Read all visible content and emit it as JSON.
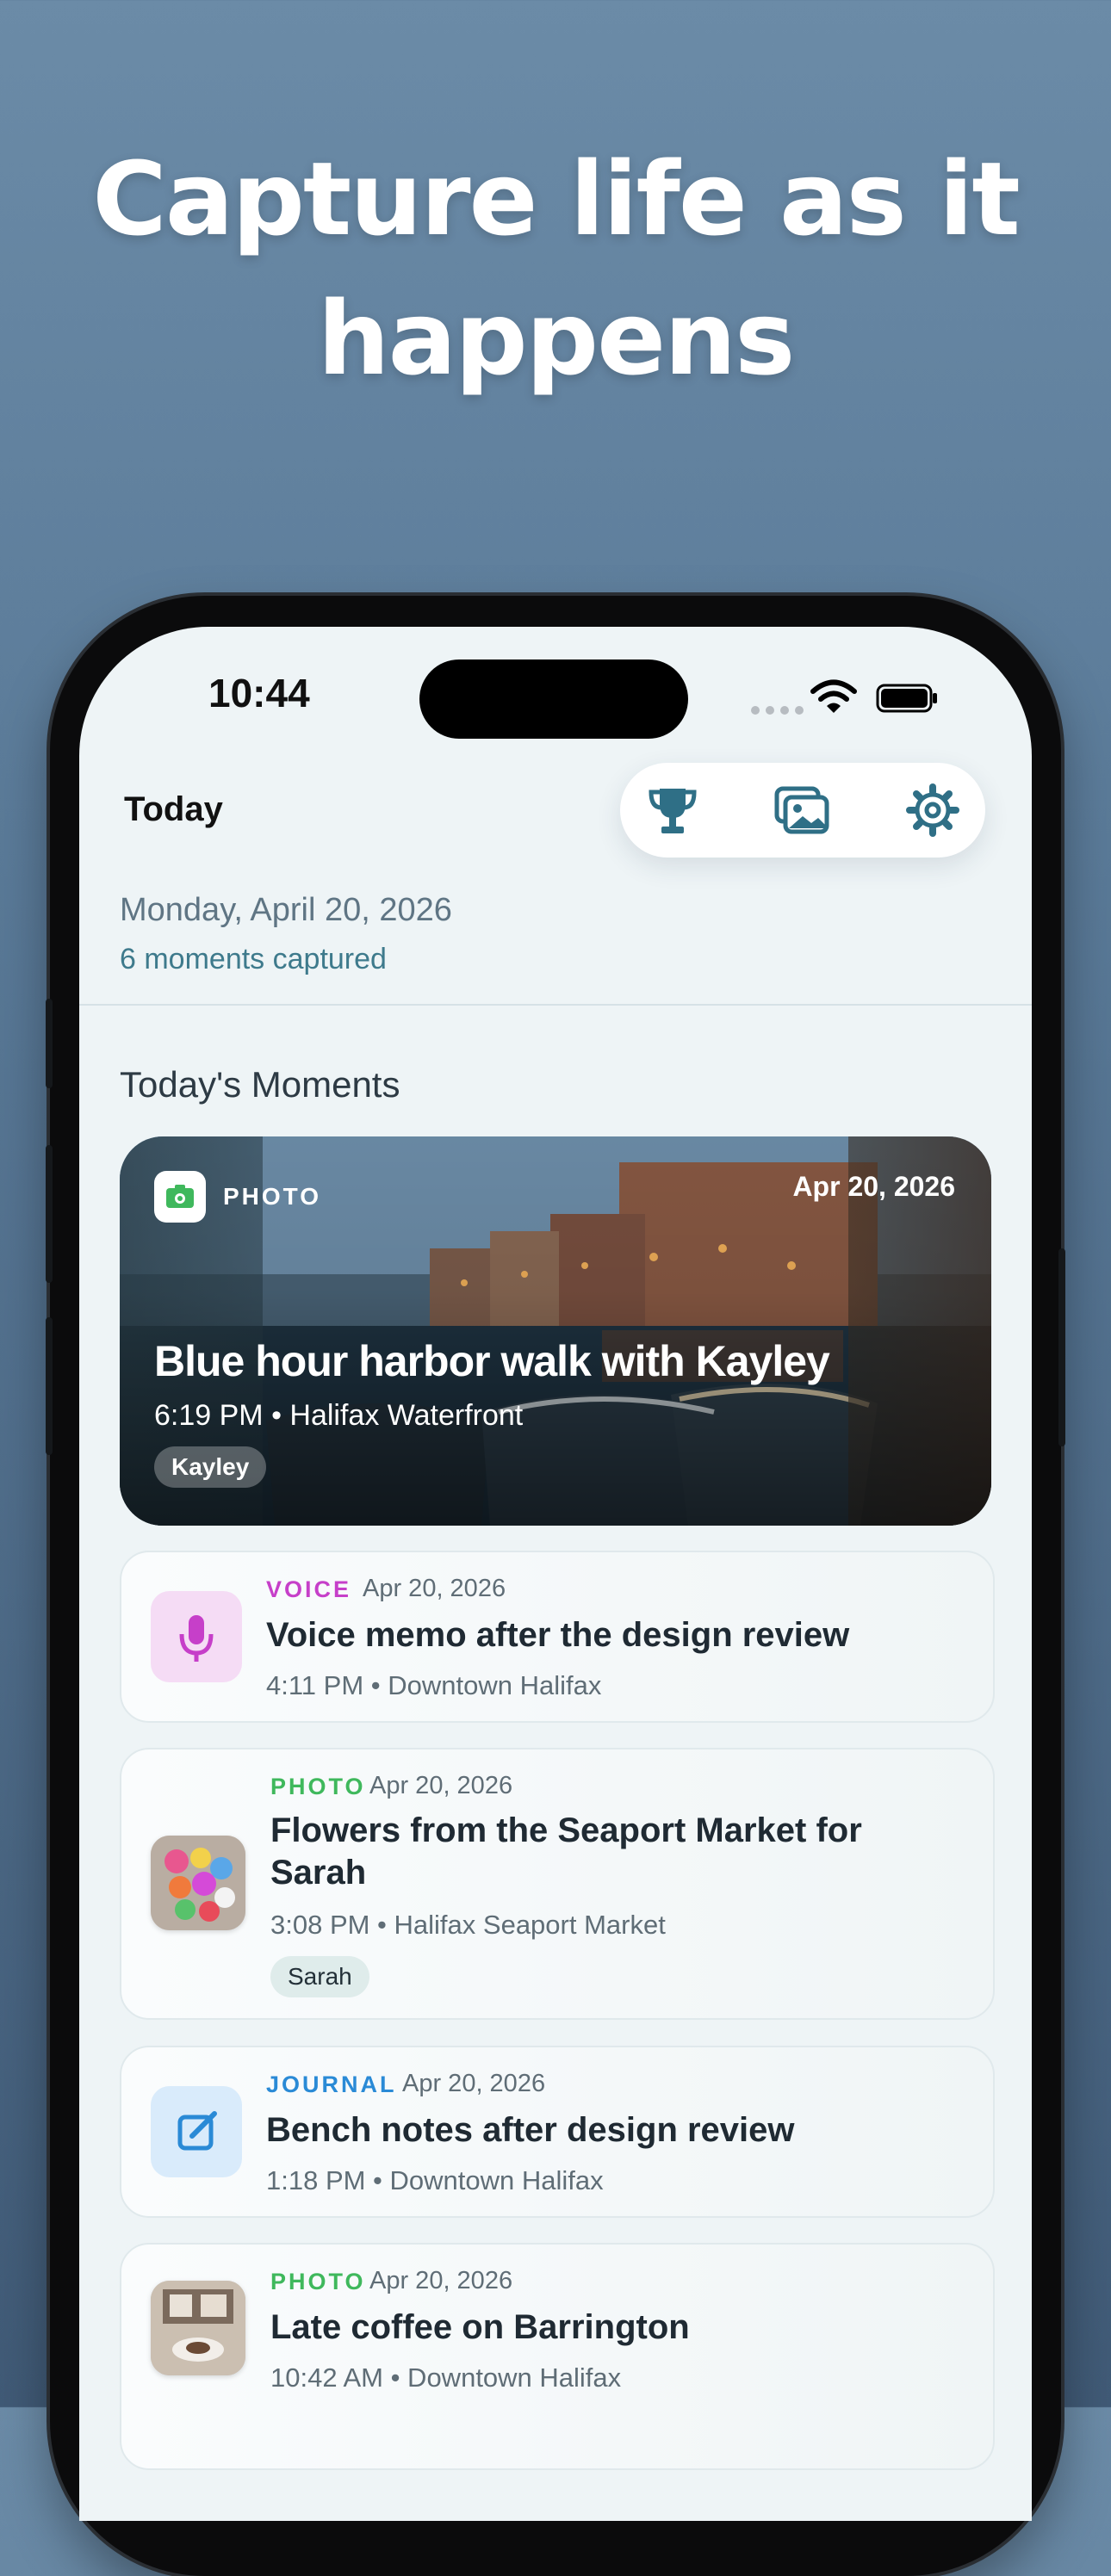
{
  "headline": {
    "line1": "Capture life as it",
    "line2": "happens"
  },
  "status_bar": {
    "time": "10:44"
  },
  "header": {
    "title": "Today"
  },
  "summary": {
    "date": "Monday, April 20, 2026",
    "count": "6 moments captured"
  },
  "section_title": "Today's Moments",
  "featured": {
    "kind": "PHOTO",
    "date": "Apr 20, 2026",
    "title": "Blue hour harbor walk with Kayley",
    "meta": "6:19 PM • Halifax Waterfront",
    "tag": "Kayley"
  },
  "moments": [
    {
      "kind": "VOICE",
      "date": "Apr 20, 2026",
      "title": "Voice memo after the design review",
      "meta": "4:11 PM • Downtown Halifax"
    },
    {
      "kind": "PHOTO",
      "date": "Apr 20, 2026",
      "title": "Flowers from the Seaport Market for Sarah",
      "meta": "3:08 PM • Halifax Seaport Market",
      "tag": "Sarah"
    },
    {
      "kind": "JOURNAL",
      "date": "Apr 20, 2026",
      "title": "Bench notes after design review",
      "meta": "1:18 PM • Downtown Halifax"
    },
    {
      "kind": "PHOTO",
      "date": "Apr 20, 2026",
      "title": "Late coffee on Barrington",
      "meta": "10:42 AM • Downtown Halifax"
    }
  ],
  "colors": {
    "voice": "#c63fc9",
    "photo": "#3fb85c",
    "journal": "#2a8ad6",
    "accent": "#2f6f86"
  },
  "icons": [
    "trophy-icon",
    "gallery-icon",
    "gear-icon",
    "camera-icon",
    "microphone-icon",
    "edit-icon"
  ]
}
